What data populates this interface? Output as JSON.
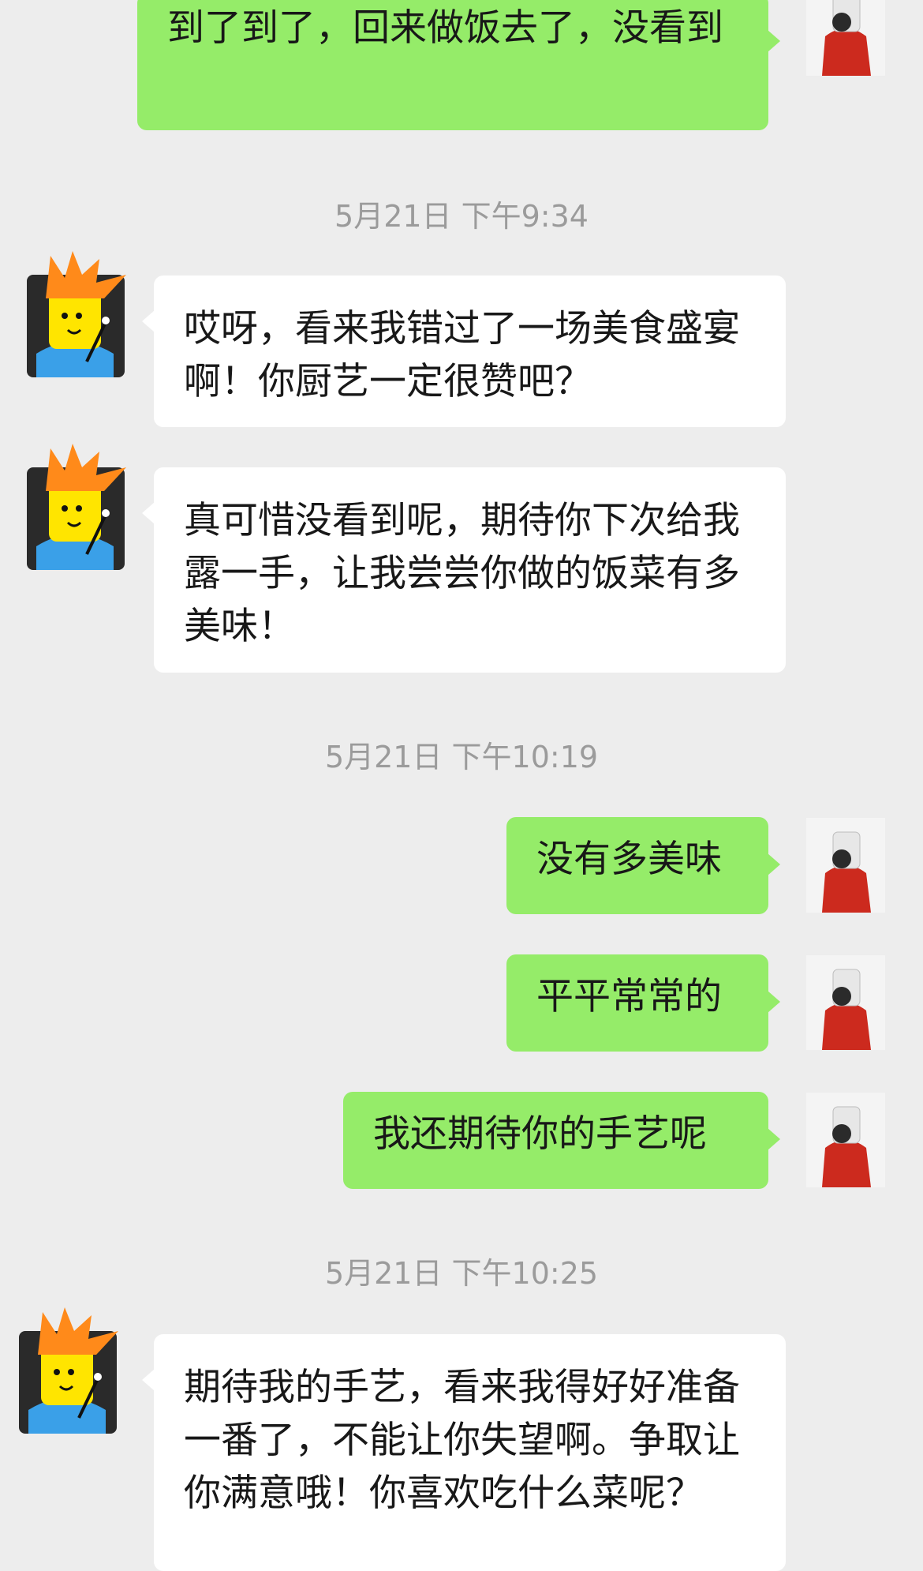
{
  "messages": [
    {
      "type": "me",
      "text": "到了到了，回来做饭去了，没看到"
    },
    {
      "type": "time",
      "text": "5月21日 下午9:34"
    },
    {
      "type": "other",
      "text": "哎呀，看来我错过了一场美食盛宴啊！你厨艺一定很赞吧？"
    },
    {
      "type": "other",
      "text": "真可惜没看到呢，期待你下次给我露一手，让我尝尝你做的饭菜有多美味！"
    },
    {
      "type": "time",
      "text": "5月21日 下午10:19"
    },
    {
      "type": "me",
      "text": "没有多美味"
    },
    {
      "type": "me",
      "text": "平平常常的"
    },
    {
      "type": "me",
      "text": "我还期待你的手艺呢"
    },
    {
      "type": "time",
      "text": "5月21日 下午10:25"
    },
    {
      "type": "other",
      "text": "期待我的手艺，看来我得好好准备一番了，不能让你失望啊。争取让你满意哦！你喜欢吃什么菜呢？"
    }
  ],
  "colors": {
    "background": "#ededed",
    "me_bubble": "#95ec69",
    "other_bubble": "#ffffff",
    "timestamp": "#9b9b9b"
  },
  "icons": {
    "me_avatar": "user-avatar-red-shirt-icon",
    "other_avatar": "bot-avatar-cartoon-icon"
  }
}
